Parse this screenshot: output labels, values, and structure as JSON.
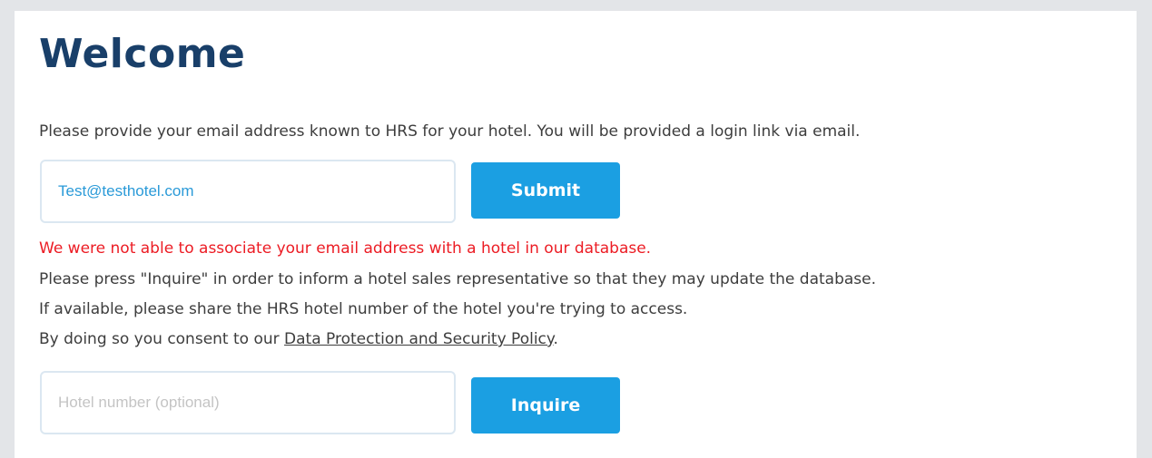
{
  "page": {
    "title": "Welcome",
    "intro": "Please provide your email address known to HRS for your hotel. You will be provided a login link via email."
  },
  "email_form": {
    "value": "Test@testhotel.com",
    "submit_label": "Submit"
  },
  "error": {
    "message": "We were not able to associate your email address with a hotel in our database."
  },
  "info": {
    "line1": "Please press \"Inquire\" in order to inform a hotel sales representative so that they may update the database.",
    "line2": "If available, please share the HRS hotel number of the hotel you're trying to access.",
    "line3_prefix": "By doing so you consent to our ",
    "policy_link": "Data Protection and Security Policy",
    "line3_suffix": "."
  },
  "inquiry_form": {
    "placeholder": "Hotel number (optional)",
    "value": "",
    "inquire_label": "Inquire"
  },
  "colors": {
    "title": "#193f69",
    "button": "#1b9fe2",
    "error": "#ec1c24",
    "email_text": "#2a9ad8"
  }
}
